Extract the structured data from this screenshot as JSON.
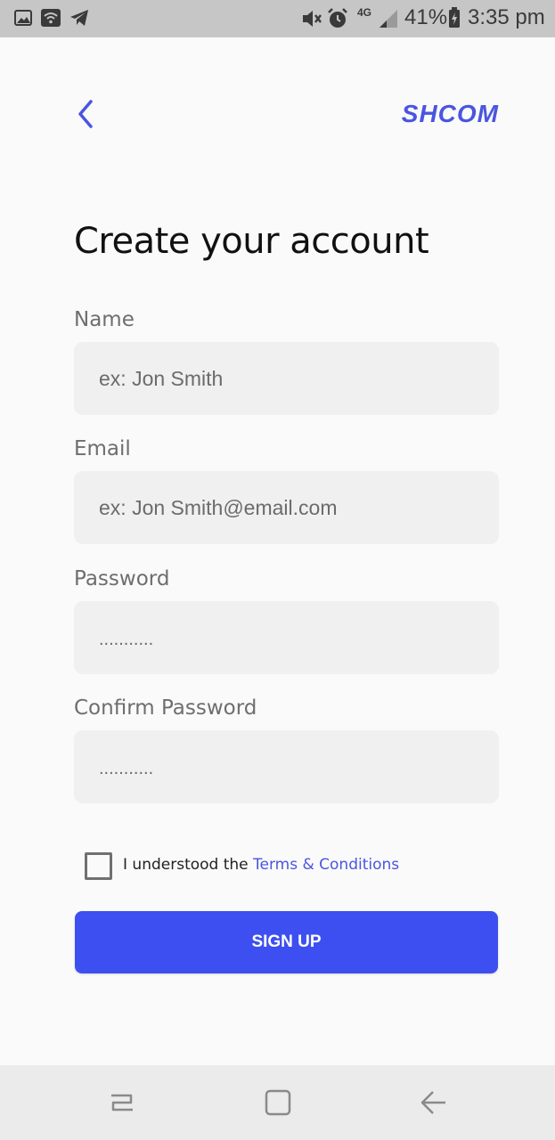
{
  "status_bar": {
    "battery": "41%",
    "time": "3:35 pm",
    "network": "4G",
    "icons": [
      "image-icon",
      "wifi-icon",
      "telegram-icon",
      "mute-icon",
      "alarm-icon",
      "signal-icon",
      "battery-icon"
    ]
  },
  "header": {
    "back_icon": "chevron-left-icon",
    "brand": "SHCOM"
  },
  "title": "Create your account",
  "form": {
    "name": {
      "label": "Name",
      "placeholder": "ex: Jon Smith"
    },
    "email": {
      "label": "Email",
      "placeholder": "ex: Jon Smith@email.com"
    },
    "password": {
      "label": "Password",
      "placeholder": "..........."
    },
    "confirm_password": {
      "label": "Confirm Password",
      "placeholder": "..........."
    }
  },
  "terms": {
    "prefix": "I understood the ",
    "link": "Terms & Conditions",
    "checked": false
  },
  "signup_label": "SIGN UP",
  "nav": {
    "icons": [
      "recents-icon",
      "home-icon",
      "back-arrow-icon"
    ]
  },
  "colors": {
    "accent": "#3d4ff0",
    "brand": "#4a55e0",
    "input_bg": "#f0f0f0",
    "page_bg": "#fafafa",
    "status_bar_bg": "#c6c6c6"
  }
}
